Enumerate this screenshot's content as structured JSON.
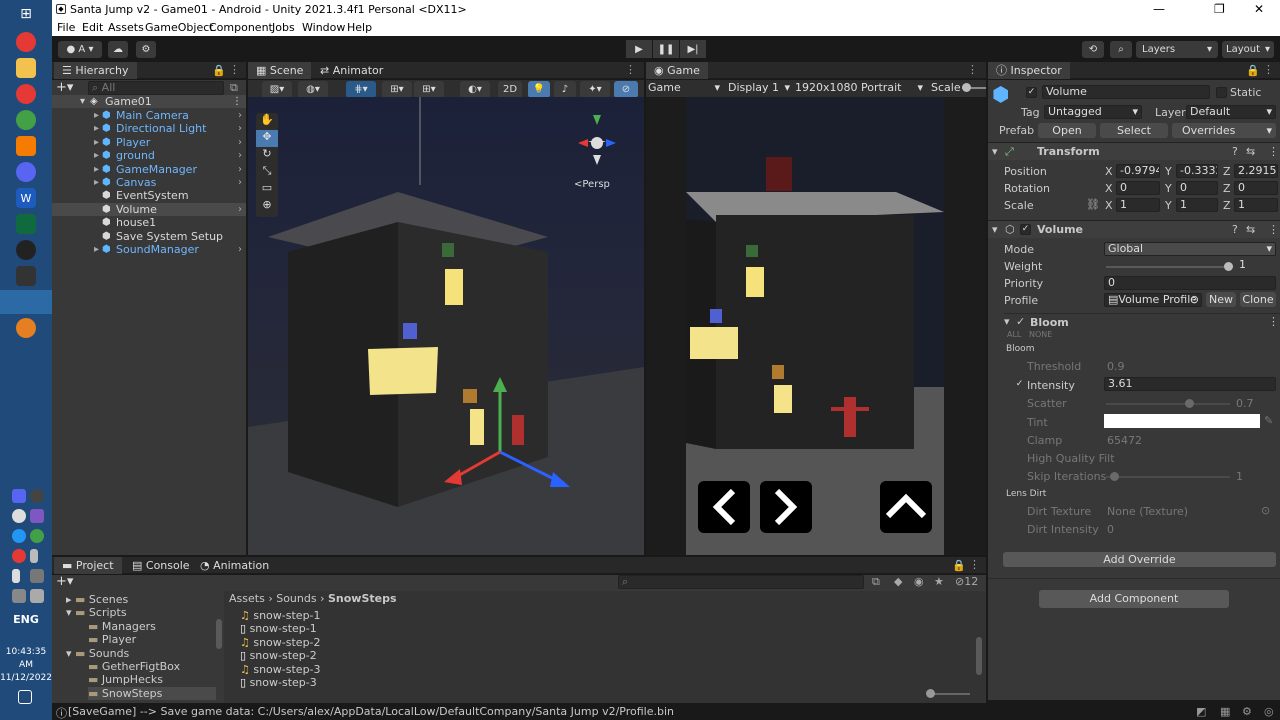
{
  "window": {
    "title": "Santa Jump v2 - Game01 - Android - Unity 2021.3.4f1 Personal <DX11>",
    "controls": [
      "—",
      "❐",
      "✕"
    ]
  },
  "menu": [
    "File",
    "Edit",
    "Assets",
    "GameObject",
    "Component",
    "Jobs",
    "Window",
    "Help"
  ],
  "toolbar": {
    "account": "A",
    "layers": "Layers",
    "layout": "Layout"
  },
  "taskbar": {
    "lang": "ENG",
    "time": "10:43:35 AM",
    "date": "11/12/2022"
  },
  "hierarchy": {
    "tab": "Hierarchy",
    "search_placeholder": "All",
    "root": "Game01",
    "items": [
      {
        "label": "Main Camera",
        "color": "blue"
      },
      {
        "label": "Directional Light",
        "color": "blue"
      },
      {
        "label": "Player",
        "color": "blue"
      },
      {
        "label": "ground",
        "color": "blue"
      },
      {
        "label": "GameManager",
        "color": "blue"
      },
      {
        "label": "Canvas",
        "color": "blue"
      },
      {
        "label": "EventSystem",
        "color": "white"
      },
      {
        "label": "Volume",
        "color": "white"
      },
      {
        "label": "house1",
        "color": "white"
      },
      {
        "label": "Save System Setup",
        "color": "white"
      },
      {
        "label": "SoundManager",
        "color": "blue"
      }
    ]
  },
  "scene": {
    "tabs": [
      "Scene",
      "Animator"
    ],
    "mode_2d": "2D",
    "persp": "<Persp"
  },
  "game": {
    "tab": "Game",
    "display_dropdown": "Game",
    "display": "Display 1",
    "resolution": "1920x1080 Portrait",
    "scale": "Scale"
  },
  "inspector": {
    "tab": "Inspector",
    "object_name": "Volume",
    "static_label": "Static",
    "tag_label": "Tag",
    "tag_value": "Untagged",
    "layer_label": "Layer",
    "layer_value": "Default",
    "prefab_label": "Prefab",
    "prefab_open": "Open",
    "prefab_select": "Select",
    "prefab_overrides": "Overrides",
    "transform": {
      "title": "Transform",
      "position_label": "Position",
      "position": [
        "-0.9794",
        "-0.3332",
        "2.29152"
      ],
      "rotation_label": "Rotation",
      "rotation": [
        "0",
        "0",
        "0"
      ],
      "scale_label": "Scale",
      "scale": [
        "1",
        "1",
        "1"
      ]
    },
    "volume": {
      "title": "Volume",
      "mode_label": "Mode",
      "mode_value": "Global",
      "weight_label": "Weight",
      "weight_value": "1",
      "priority_label": "Priority",
      "priority_value": "0",
      "profile_label": "Profile",
      "profile_value": "Volume Profile",
      "new_button": "New",
      "clone_button": "Clone"
    },
    "bloom": {
      "title": "Bloom",
      "all": "ALL",
      "none": "NONE",
      "group": "Bloom",
      "threshold_label": "Threshold",
      "threshold_value": "0.9",
      "intensity_label": "Intensity",
      "intensity_value": "3.61",
      "scatter_label": "Scatter",
      "scatter_value": "0.7",
      "tint_label": "Tint",
      "clamp_label": "Clamp",
      "clamp_value": "65472",
      "hq_label": "High Quality Filt",
      "skip_label": "Skip Iterations",
      "skip_value": "1",
      "lens_dirt": "Lens Dirt",
      "dirt_texture_label": "Dirt Texture",
      "dirt_texture_value": "None (Texture)",
      "dirt_intensity_label": "Dirt Intensity",
      "dirt_intensity_value": "0"
    },
    "add_override": "Add Override",
    "add_component": "Add Component"
  },
  "project": {
    "tabs": [
      "Project",
      "Console",
      "Animation"
    ],
    "tree": [
      {
        "label": "Scenes",
        "indent": 0
      },
      {
        "label": "Scripts",
        "indent": 0
      },
      {
        "label": "Managers",
        "indent": 1
      },
      {
        "label": "Player",
        "indent": 1
      },
      {
        "label": "Sounds",
        "indent": 0
      },
      {
        "label": "GetherFigtBox",
        "indent": 1
      },
      {
        "label": "JumpHecks",
        "indent": 1
      },
      {
        "label": "SnowSteps",
        "indent": 1
      }
    ],
    "breadcrumb": [
      "Assets",
      "Sounds",
      "SnowSteps"
    ],
    "files": [
      {
        "name": "snow-step-1",
        "icon": "audio"
      },
      {
        "name": "snow-step-1",
        "icon": "doc"
      },
      {
        "name": "snow-step-2",
        "icon": "audio"
      },
      {
        "name": "snow-step-2",
        "icon": "doc"
      },
      {
        "name": "snow-step-3",
        "icon": "audio"
      },
      {
        "name": "snow-step-3",
        "icon": "doc"
      }
    ],
    "hidden_count": "12"
  },
  "status": {
    "message": "[SaveGame] --> Save game data: C:/Users/alex/AppData/LocalLow/DefaultCompany/Santa Jump v2/Profile.bin"
  }
}
